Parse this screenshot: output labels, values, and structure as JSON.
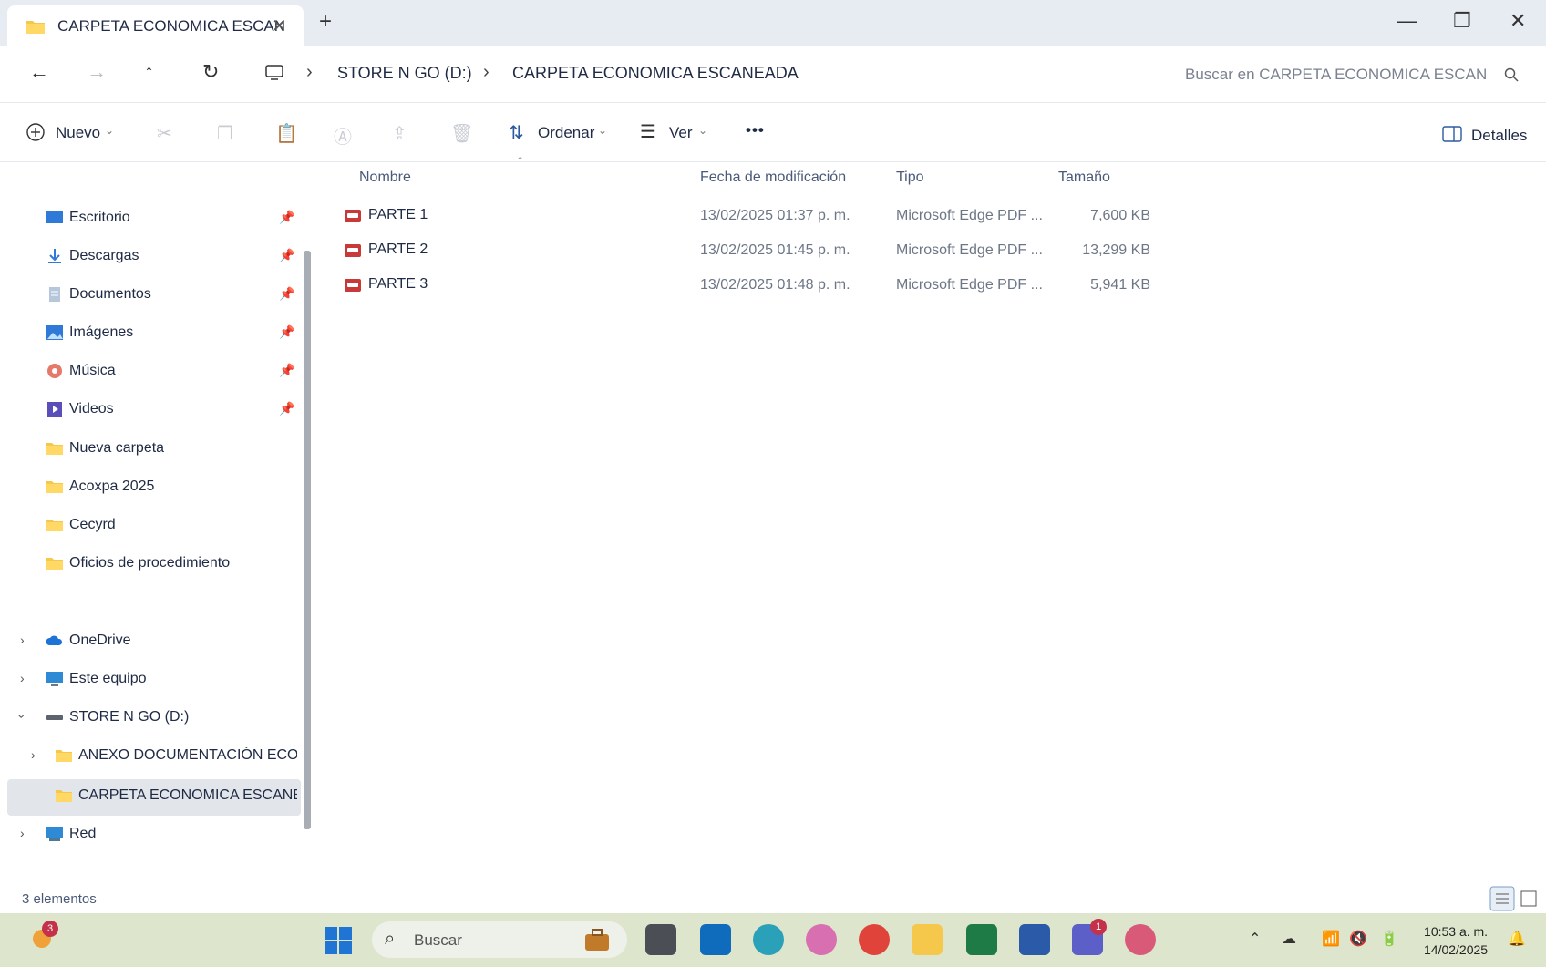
{
  "window": {
    "tab_title": "CARPETA ECONOMICA ESCAN",
    "tab_close": "✕",
    "new_tab": "+",
    "minimize": "—",
    "restore": "❐",
    "close": "✕"
  },
  "address": {
    "breadcrumb": [
      "STORE N GO (D:)",
      "CARPETA ECONOMICA ESCANEADA"
    ],
    "search_placeholder": "Buscar en CARPETA ECONOMICA ESCAN"
  },
  "toolbar": {
    "new_label": "Nuevo",
    "sort_label": "Ordenar",
    "view_label": "Ver",
    "more_label": "•••",
    "details_label": "Detalles"
  },
  "sidebar": {
    "quick_access": [
      {
        "label": "Escritorio",
        "icon": "desktop-icon"
      },
      {
        "label": "Descargas",
        "icon": "download-icon"
      },
      {
        "label": "Documentos",
        "icon": "document-icon"
      },
      {
        "label": "Imágenes",
        "icon": "image-icon"
      },
      {
        "label": "Música",
        "icon": "music-icon"
      },
      {
        "label": "Videos",
        "icon": "video-icon"
      },
      {
        "label": "Nueva carpeta",
        "icon": "folder-icon"
      },
      {
        "label": "Acoxpa 2025",
        "icon": "folder-icon"
      },
      {
        "label": "Cecyrd",
        "icon": "folder-icon"
      },
      {
        "label": "Oficios de procedimiento",
        "icon": "folder-icon"
      }
    ],
    "locations": [
      {
        "label": "OneDrive",
        "icon": "cloud-icon"
      },
      {
        "label": "Este equipo",
        "icon": "computer-icon"
      },
      {
        "label": "STORE N GO (D:)",
        "icon": "drive-icon"
      },
      {
        "label": "ANEXO DOCUMENTACIÓN ECONO",
        "icon": "folder-icon"
      },
      {
        "label": "CARPETA ECONOMICA ESCANEAD",
        "icon": "folder-icon"
      },
      {
        "label": "Red",
        "icon": "network-icon"
      }
    ]
  },
  "file_list": {
    "headers": {
      "name": "Nombre",
      "modified": "Fecha de modificación",
      "type": "Tipo",
      "size": "Tamaño"
    },
    "rows": [
      {
        "name": "PARTE 1",
        "modified": "13/02/2025 01:37 p. m.",
        "type": "Microsoft Edge PDF ...",
        "size": "7,600 KB"
      },
      {
        "name": "PARTE 2",
        "modified": "13/02/2025 01:45 p. m.",
        "type": "Microsoft Edge PDF ...",
        "size": "13,299 KB"
      },
      {
        "name": "PARTE 3",
        "modified": "13/02/2025 01:48 p. m.",
        "type": "Microsoft Edge PDF ...",
        "size": "5,941 KB"
      }
    ]
  },
  "status": {
    "item_count": "3 elementos"
  },
  "taskbar": {
    "search_label": "Buscar",
    "weather_badge": "3",
    "teams_badge": "1",
    "time": "10:53 a. m.",
    "date": "14/02/2025"
  }
}
